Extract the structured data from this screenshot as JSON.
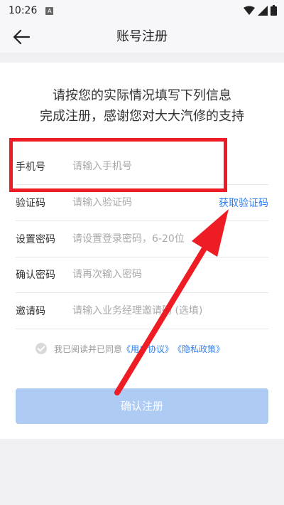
{
  "status_bar": {
    "time": "10:26",
    "notification_letter": "A",
    "icons": [
      "wifi-icon",
      "signal-icon",
      "battery-icon"
    ]
  },
  "nav": {
    "title": "账号注册",
    "back_icon": "arrow-left-icon"
  },
  "intro": {
    "line1": "请按您的实际情况填写下列信息",
    "line2": "完成注册，感谢您对大大汽修的支持"
  },
  "form": {
    "phone": {
      "label": "手机号",
      "placeholder": "请输入手机号",
      "value": ""
    },
    "code": {
      "label": "验证码",
      "placeholder": "请输入验证码",
      "value": "",
      "action": "获取验证码"
    },
    "password": {
      "label": "设置密码",
      "placeholder": "请设置登录密码，6-20位",
      "value": ""
    },
    "confirm": {
      "label": "确认密码",
      "placeholder": "请再次输入密码",
      "value": ""
    },
    "invite": {
      "label": "邀请码",
      "placeholder": "请输入业务经理邀请码 (选填)",
      "value": ""
    }
  },
  "agreement": {
    "checked": false,
    "prefix": "我已阅读并已同意",
    "user_agreement": "《用户协议》",
    "privacy_policy": "《隐私政策》"
  },
  "submit": {
    "label": "确认注册"
  },
  "colors": {
    "accent": "#2f7ff0",
    "button_disabled": "#aecbf3",
    "annotation": "#ee1c24"
  }
}
